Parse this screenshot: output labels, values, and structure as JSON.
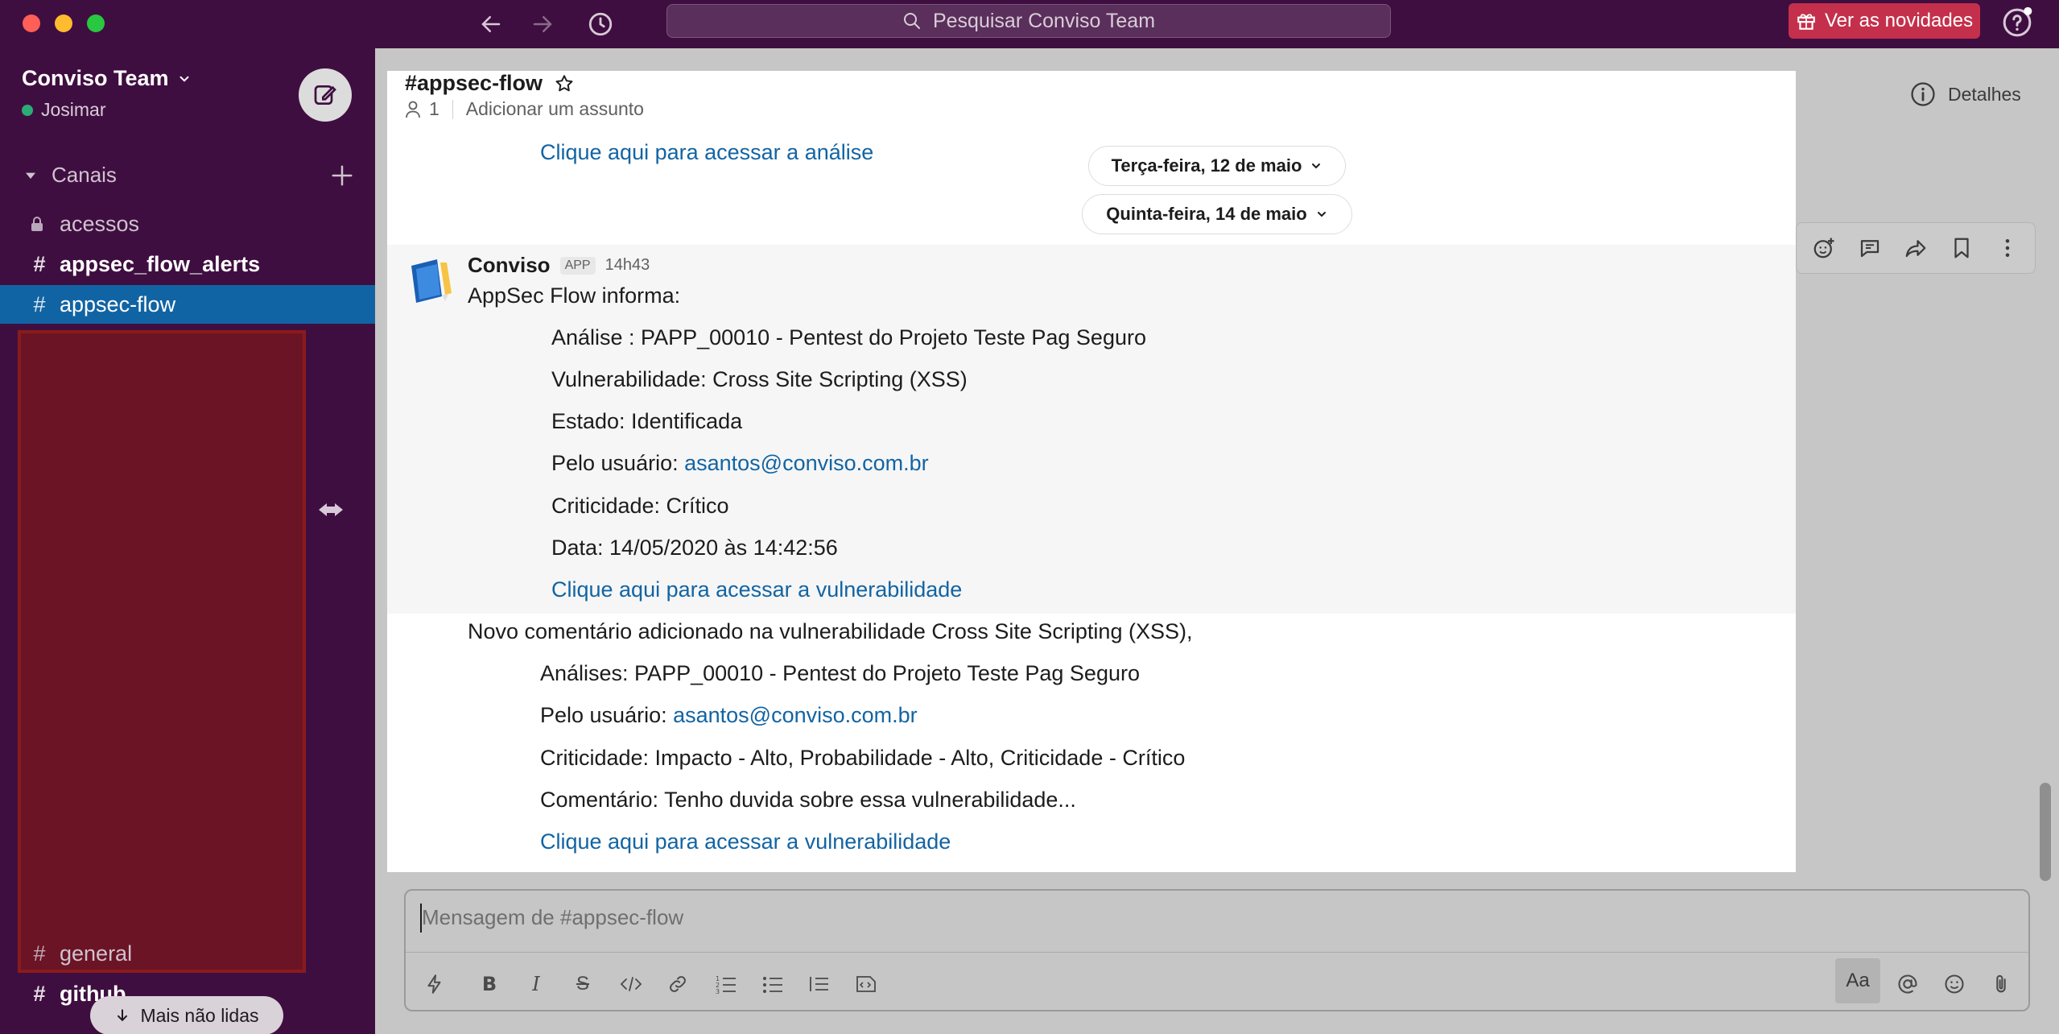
{
  "window": {
    "search_placeholder": "Pesquisar Conviso Team",
    "news_button": "Ver as novidades",
    "traffic_colors": [
      "#ff5f57",
      "#febc2e",
      "#28c840"
    ]
  },
  "sidebar": {
    "workspace_name": "Conviso Team",
    "user_name": "Josimar",
    "section_label": "Canais",
    "channels": [
      {
        "label": "acessos",
        "prefix": "lock"
      },
      {
        "label": "appsec_flow_alerts",
        "prefix": "#"
      },
      {
        "label": "appsec-flow",
        "prefix": "#"
      },
      {
        "label": "general",
        "prefix": "#"
      },
      {
        "label": "github",
        "prefix": "#"
      }
    ],
    "unread_pill": "Mais não lidas"
  },
  "header": {
    "details_label": "Detalhes"
  },
  "channel": {
    "title": "#appsec-flow",
    "member_count": "1",
    "topic_placeholder": "Adicionar um assunto"
  },
  "messages": {
    "prev_link": "Clique aqui para acessar a análise",
    "date1": "Terça-feira, 12 de maio",
    "date2": "Quinta-feira, 14 de maio",
    "sender": "Conviso",
    "app_badge": "APP",
    "time": "14h43",
    "intro": "AppSec Flow informa:",
    "analysis": "Análise : PAPP_00010 - Pentest do Projeto Teste Pag Seguro",
    "vuln": "Vulnerabilidade: Cross Site Scripting (XSS)",
    "state": "Estado: Identificada",
    "user_label": "Pelo usuário: ",
    "user_email": "asantos@conviso.com.br",
    "criticality": "Criticidade: Crítico",
    "date_text": "Data: 14/05/2020 às 14:42:56",
    "vuln_link": "Clique aqui para acessar a vulnerabilidade",
    "comment_intro": "Novo comentário adicionado na vulnerabilidade Cross Site Scripting (XSS),",
    "c_analysis": "Análises: PAPP_00010 - Pentest do Projeto Teste Pag Seguro",
    "c_user_label": "Pelo usuário: ",
    "c_user_email": "asantos@conviso.com.br",
    "c_criticality": "Criticidade: Impacto - Alto, Probabilidade - Alto, Criticidade - Crítico",
    "c_comment": "Comentário: Tenho duvida sobre essa vulnerabilidade...",
    "c_link": "Clique aqui para acessar a vulnerabilidade"
  },
  "composer": {
    "placeholder": "Mensagem de #appsec-flow",
    "aa_label": "Aa"
  }
}
